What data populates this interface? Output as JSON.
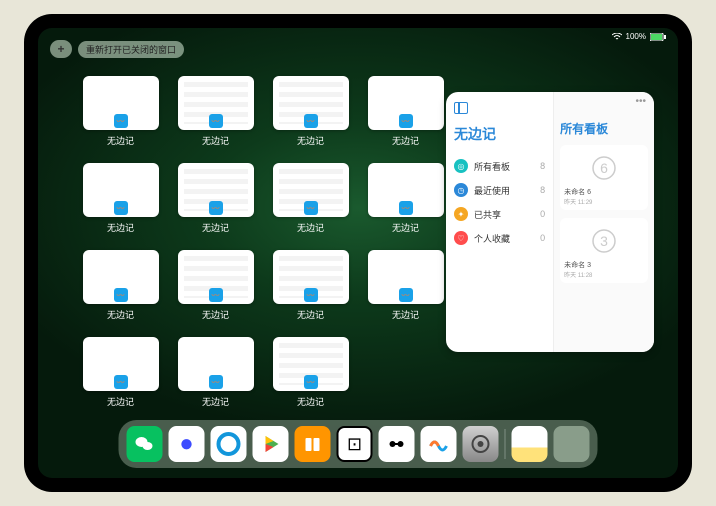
{
  "status": {
    "battery": "100%"
  },
  "topbar": {
    "plus": "+",
    "reopen_label": "重新打开已关闭的窗口"
  },
  "expose": {
    "app_label": "无边记",
    "windows": [
      {
        "content": false
      },
      {
        "content": true
      },
      {
        "content": true
      },
      {
        "content": false
      },
      {
        "content": false
      },
      {
        "content": true
      },
      {
        "content": true
      },
      {
        "content": false
      },
      {
        "content": false
      },
      {
        "content": true
      },
      {
        "content": true
      },
      {
        "content": false
      },
      {
        "content": false
      },
      {
        "content": false
      },
      {
        "content": true
      }
    ],
    "layout": [
      4,
      4,
      4,
      3
    ]
  },
  "panel": {
    "title": "无边记",
    "right_title": "所有看板",
    "nav": [
      {
        "label": "所有看板",
        "count": 8,
        "color": "#18c1c1",
        "glyph": "◎"
      },
      {
        "label": "最近使用",
        "count": 8,
        "color": "#2b88d8",
        "glyph": "◷"
      },
      {
        "label": "已共享",
        "count": 0,
        "color": "#f5a623",
        "glyph": "✦"
      },
      {
        "label": "个人收藏",
        "count": 0,
        "color": "#ff4d4d",
        "glyph": "♡"
      }
    ],
    "boards": [
      {
        "sketch": "6",
        "name": "未命名 6",
        "time": "昨天 11:29"
      },
      {
        "sketch": "3",
        "name": "未命名 3",
        "time": "昨天 11:28"
      }
    ]
  },
  "dock": [
    {
      "name": "wechat",
      "glyph": "✶"
    },
    {
      "name": "quark",
      "glyph": "●"
    },
    {
      "name": "qqbrowser",
      "glyph": "Q"
    },
    {
      "name": "play",
      "glyph": "▶"
    },
    {
      "name": "books",
      "glyph": "▮▮"
    },
    {
      "name": "dots",
      "glyph": "⊡"
    },
    {
      "name": "bw",
      "glyph": "✕"
    },
    {
      "name": "freeform",
      "glyph": "〰"
    },
    {
      "name": "settings",
      "glyph": "⚙"
    },
    {
      "name": "notes",
      "glyph": ""
    },
    {
      "name": "folder",
      "glyph": ""
    }
  ]
}
